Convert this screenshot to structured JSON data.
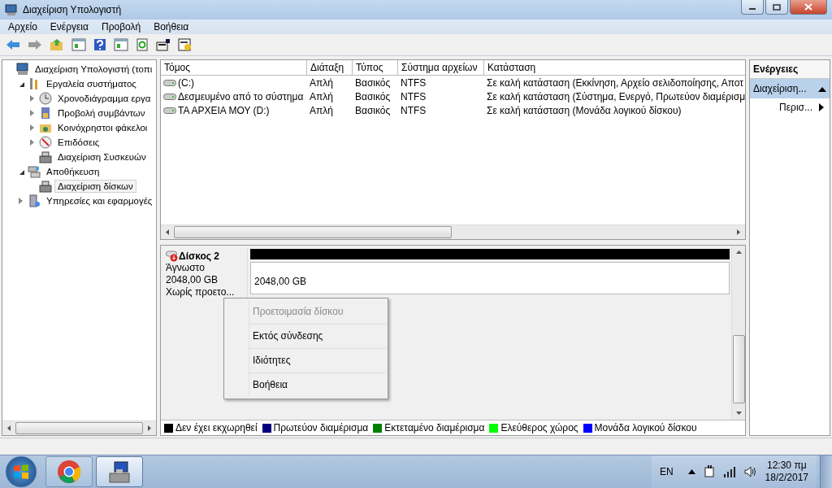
{
  "window": {
    "title": "Διαχείριση Υπολογιστή"
  },
  "menu": [
    "Αρχείο",
    "Ενέργεια",
    "Προβολή",
    "Βοήθεια"
  ],
  "toolbar": [
    {
      "kind": "back",
      "disabled": false
    },
    {
      "kind": "forward",
      "disabled": true
    },
    {
      "kind": "up"
    },
    {
      "kind": "pane"
    },
    {
      "kind": "help"
    },
    {
      "kind": "pane"
    },
    {
      "kind": "refresh"
    },
    {
      "kind": "properties"
    },
    {
      "kind": "export"
    }
  ],
  "tree": [
    {
      "label": "Διαχείριση Υπολογιστή (τοπι",
      "kind": "computer",
      "selected": false,
      "children": [
        {
          "label": "Εργαλεία συστήματος",
          "kind": "tools",
          "expanded": true,
          "selected": false,
          "children": [
            {
              "label": "Χρονοδιάγραμμα εργα",
              "kind": "clock",
              "expanded": false,
              "selected": false
            },
            {
              "label": "Προβολή συμβάντων",
              "kind": "log",
              "expanded": false,
              "selected": false
            },
            {
              "label": "Κοινόχρηστοι φάκελοι",
              "kind": "folder",
              "expanded": false,
              "selected": false
            },
            {
              "label": "Επιδόσεις",
              "kind": "gauge",
              "expanded": false,
              "selected": false
            },
            {
              "label": "Διαχείριση Συσκευών",
              "kind": "device",
              "selected": false
            }
          ]
        },
        {
          "label": "Αποθήκευση",
          "kind": "storage",
          "expanded": true,
          "selected": false,
          "children": [
            {
              "label": "Διαχείριση δίσκων",
              "kind": "device",
              "selected": true
            }
          ]
        },
        {
          "label": "Υπηρεσίες και εφαρμογές",
          "kind": "services",
          "expanded": false,
          "selected": false
        }
      ]
    }
  ],
  "table": {
    "columns": [
      "Τόμος",
      "Διάταξη",
      "Τύπος",
      "Σύστημα αρχείων",
      "Κατάσταση"
    ],
    "rows": [
      {
        "cells": [
          "(C:)",
          "Απλή",
          "Βασικός",
          "NTFS",
          "Σε καλή κατάσταση (Εκκίνηση, Αρχείο σελιδοποίησης, Αποτ"
        ]
      },
      {
        "cells": [
          "Δεσμευμένο από το σύστημα",
          "Απλή",
          "Βασικός",
          "NTFS",
          "Σε καλή κατάσταση (Σύστημα, Ενεργό, Πρωτεύον διαμέρισμ"
        ]
      },
      {
        "cells": [
          "ΤΑ ΑΡΧΕΙΑ ΜΟΥ (D:)",
          "Απλή",
          "Βασικός",
          "NTFS",
          "Σε καλή κατάσταση (Μονάδα λογικού δίσκου)"
        ]
      }
    ]
  },
  "disk": {
    "name": "Δίσκος 2",
    "type": "Άγνωστο",
    "size": "2048,00 GB",
    "state": "Χωρίς προετο...",
    "partition": {
      "size": "2048,00 GB",
      "color": "#000000"
    }
  },
  "context_menu": [
    {
      "label": "Προετοιμασία δίσκου",
      "disabled": true
    },
    {
      "label": "Εκτός σύνδεσης",
      "disabled": false
    },
    {
      "label": "Ιδιότητες",
      "disabled": false
    },
    {
      "label": "Βοήθεια",
      "disabled": false
    }
  ],
  "legend": [
    {
      "label": "Δεν έχει εκχωρηθεί",
      "color": "#000000"
    },
    {
      "label": "Πρωτεύον διαμέρισμα",
      "color": "#000080"
    },
    {
      "label": "Εκτεταμένο διαμέρισμα",
      "color": "#008000"
    },
    {
      "label": "Ελεύθερος χώρος",
      "color": "#00ff00"
    },
    {
      "label": "Μονάδα λογικού δίσκου",
      "color": "#0000ff"
    }
  ],
  "actions": {
    "title": "Ενέργειες",
    "items": [
      {
        "label": "Διαχείριση...",
        "kind": "section"
      },
      {
        "label": "Περισ...",
        "kind": "submenu"
      }
    ]
  },
  "taskbar": {
    "apps": [
      {
        "kind": "chrome",
        "selected": false
      },
      {
        "kind": "computer",
        "selected": true
      }
    ],
    "language": "EN",
    "time": "12:30 πμ",
    "date": "18/2/2017"
  }
}
